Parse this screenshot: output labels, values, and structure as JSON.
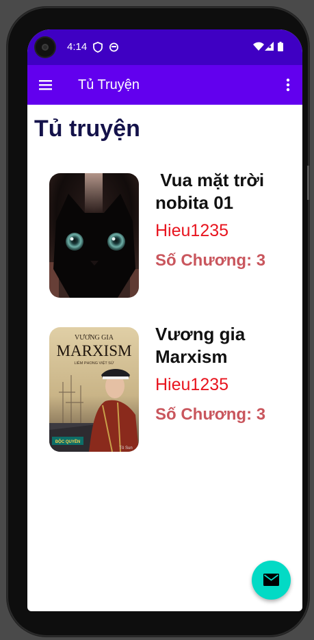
{
  "status_bar": {
    "time": "4:14",
    "icons": [
      "shield-icon",
      "robot-icon",
      "wifi-icon",
      "signal-icon",
      "battery-icon"
    ]
  },
  "app_bar": {
    "title": "Tủ Truyện",
    "menu_icon": "menu-icon",
    "overflow_icon": "more-vert-icon",
    "color": "#6200ee"
  },
  "page": {
    "heading": "Tủ truyện"
  },
  "stories": [
    {
      "title": " Vua mặt trời nobita 01",
      "author": "Hieu1235",
      "chapters": "Số Chương: 3",
      "cover": "black-cat-cover"
    },
    {
      "title": "Vương gia Marxism",
      "author": "Hieu1235",
      "chapters": "Số Chương: 3",
      "cover": "marxism-book-cover",
      "cover_text": {
        "top": "VƯƠNG GIA",
        "main": "MARXISM",
        "sub": "LIÊM PHONG VIỆT SỬ",
        "badge": "ĐỘC QUYỀN",
        "corner": "Tô Sun"
      }
    }
  ],
  "fab": {
    "icon": "email-icon",
    "color": "#03dac5"
  }
}
